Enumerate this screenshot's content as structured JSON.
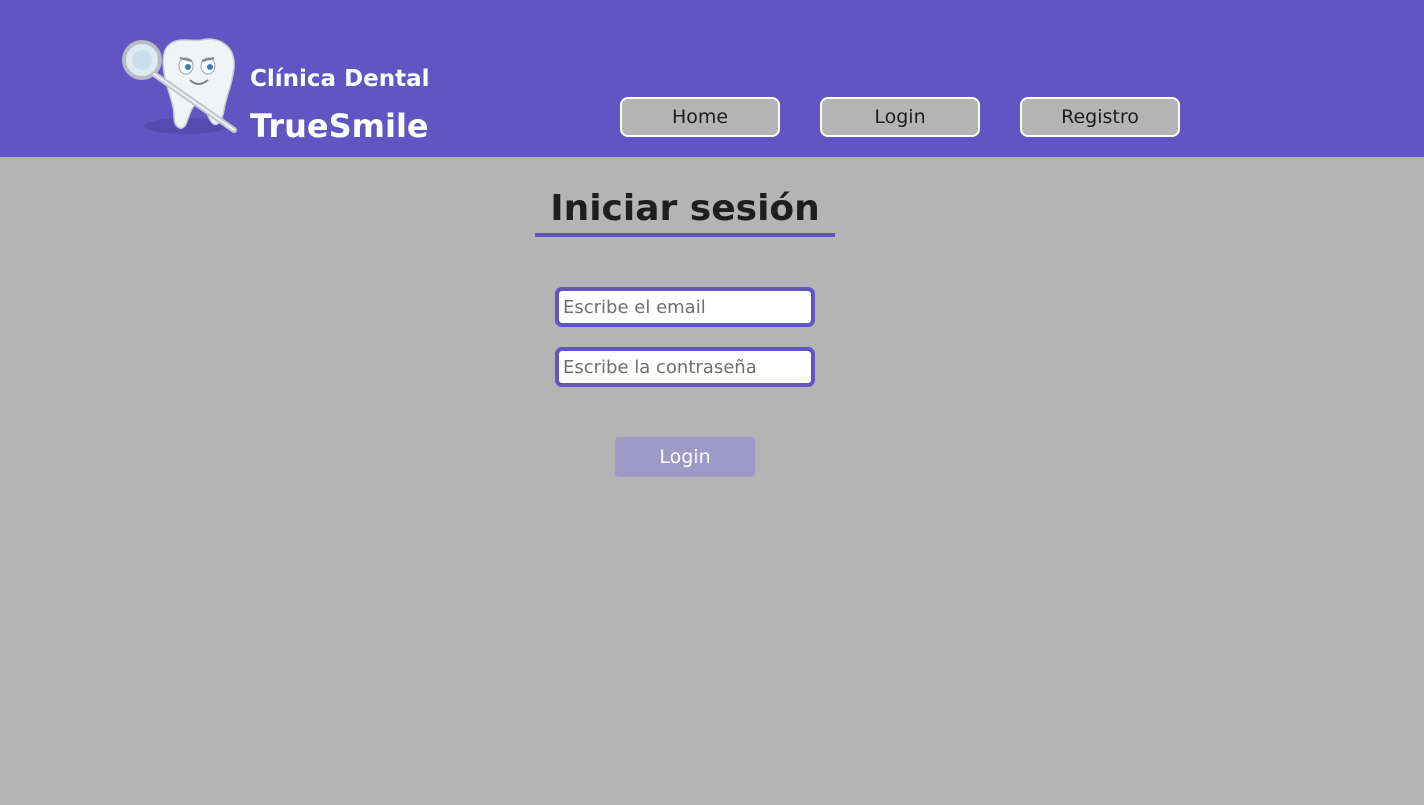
{
  "header": {
    "brand_line1": "Clínica Dental",
    "brand_line2": "TrueSmile",
    "logo_icon": "tooth-mascot-icon",
    "nav": {
      "home": "Home",
      "login": "Login",
      "registro": "Registro"
    }
  },
  "main": {
    "title": "Iniciar sesión",
    "email_placeholder": "Escribe el email",
    "password_placeholder": "Escribe la contraseña",
    "submit_label": "Login"
  },
  "colors": {
    "header_bg": "#6254c2",
    "page_bg": "#b4b4b4",
    "accent": "#6254c2",
    "button_bg": "#9f99c7"
  }
}
